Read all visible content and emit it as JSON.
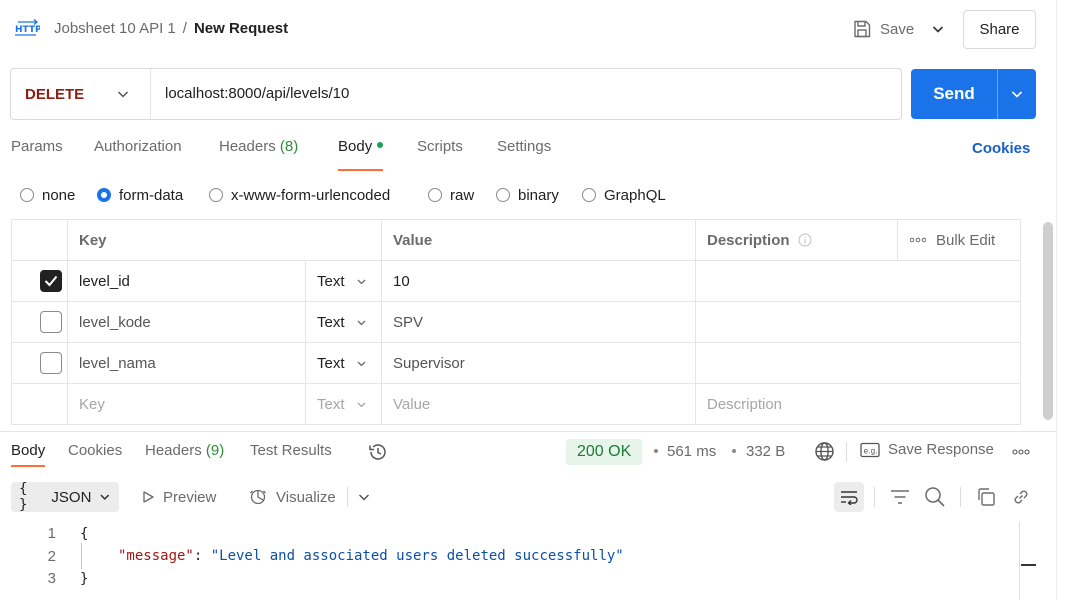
{
  "header": {
    "icon": "http-icon",
    "collection": "Jobsheet 10 API 1",
    "separator": "/",
    "request_name": "New Request",
    "save_label": "Save",
    "share_label": "Share"
  },
  "request": {
    "method": "DELETE",
    "method_color": "#8f1d12",
    "url": "localhost:8000/api/levels/10",
    "send_label": "Send",
    "send_color": "#1a73e8"
  },
  "tabs": {
    "params": "Params",
    "authorization": "Authorization",
    "headers": "Headers",
    "headers_count": "(8)",
    "body": "Body",
    "scripts": "Scripts",
    "settings": "Settings",
    "active": "Body",
    "cookies_link": "Cookies"
  },
  "body_types": {
    "options": [
      "none",
      "form-data",
      "x-www-form-urlencoded",
      "raw",
      "binary",
      "GraphQL"
    ],
    "selected": "form-data"
  },
  "table": {
    "columns": {
      "key": "Key",
      "value": "Value",
      "description": "Description",
      "bulk_edit": "Bulk Edit"
    },
    "rows": [
      {
        "checked": true,
        "key": "level_id",
        "type": "Text",
        "value": "10",
        "description": ""
      },
      {
        "checked": false,
        "key": "level_kode",
        "type": "Text",
        "value": "SPV",
        "description": ""
      },
      {
        "checked": false,
        "key": "level_nama",
        "type": "Text",
        "value": "Supervisor",
        "description": ""
      }
    ],
    "placeholder": {
      "key": "Key",
      "type": "Text",
      "value": "Value",
      "description": "Description"
    }
  },
  "response": {
    "tabs": {
      "body": "Body",
      "cookies": "Cookies",
      "headers": "Headers",
      "headers_count": "(9)",
      "test_results": "Test Results",
      "active": "Body"
    },
    "status": "200 OK",
    "status_color": "#1e7a36",
    "time": "561 ms",
    "size": "332 B",
    "save_response": "Save Response",
    "format": "JSON",
    "format_prefix": "{ }",
    "preview": "Preview",
    "visualize": "Visualize",
    "code_lines": [
      {
        "n": "1",
        "text": "{"
      },
      {
        "n": "2",
        "key": "\"message\"",
        "colon": ": ",
        "value": "\"Level and associated users deleted successfully\""
      },
      {
        "n": "3",
        "text": "}"
      }
    ]
  }
}
